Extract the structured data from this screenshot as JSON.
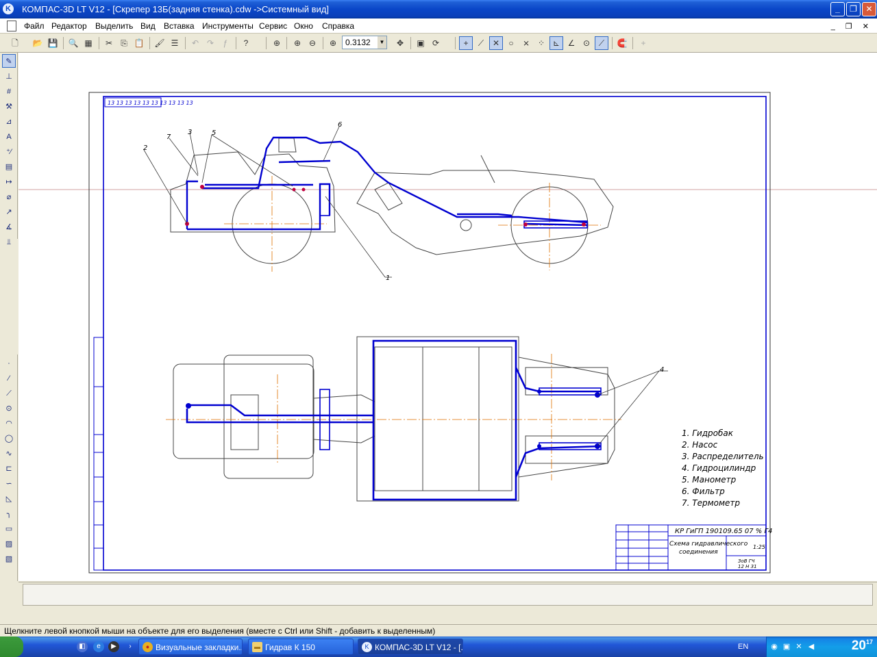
{
  "window": {
    "title": "КОМПАС-3D LT V12 - [Скрепер 13Б(задняя стенка).cdw ->Системный вид]",
    "app_icon": "K"
  },
  "menu": [
    "Файл",
    "Редактор",
    "Выделить",
    "Вид",
    "Вставка",
    "Инструменты",
    "Сервис",
    "Окно",
    "Справка"
  ],
  "toolbar": {
    "zoom_value": "0.3132"
  },
  "drawing": {
    "stamp_top": "13 13 13 13 13 13 13 13 13 13",
    "callouts": [
      "1",
      "2",
      "3",
      "4",
      "5",
      "6",
      "7"
    ],
    "legend": [
      "1. Гидробак",
      "2. Насос",
      "3. Распределитель",
      "4. Гидроцилиндр",
      "5. Манометр",
      "6. Фильтр",
      "7. Термометр"
    ],
    "title_block": {
      "code": "КР ГиГП 190109.65  07 %  Г4",
      "name_line1": "Схема гидравлического",
      "name_line2": "соединения",
      "sheet": "1:25",
      "org_line1": "ЗоВ ГЧ",
      "org_line2": "12 Н 31"
    }
  },
  "status_text": "Щелкните левой кнопкой мыши на объекте для его выделения (вместе с Ctrl или Shift - добавить к выделенным)",
  "taskbar": {
    "tasks": [
      {
        "label": "Визуальные закладки..."
      },
      {
        "label": "Гидрав К 150"
      },
      {
        "label": "КОМПАС-3D LT V12 - [..."
      }
    ],
    "lang": "EN",
    "clock": "20",
    "clock_sup": "17"
  },
  "colors": {
    "accent": "#0a46c8",
    "drawing_blue": "#0000d0",
    "axis_orange": "#e07000"
  }
}
